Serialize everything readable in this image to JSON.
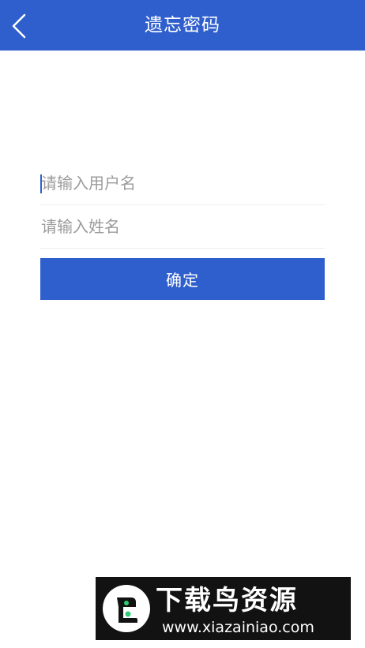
{
  "header": {
    "title": "遗忘密码",
    "back_icon": "chevron-left-icon"
  },
  "form": {
    "username_placeholder": "请输入用户名",
    "username_value": "",
    "name_placeholder": "请输入姓名",
    "name_value": "",
    "confirm_label": "确定"
  },
  "watermark": {
    "title": "下载鸟资源",
    "url": "www.xiazainiao.com",
    "logo_icon": "bird-logo-icon"
  },
  "colors": {
    "primary": "#2f5fcd",
    "background": "#ffffff",
    "placeholder": "#9b9b9b",
    "divider": "#eeeeee",
    "watermark_bg": "#121212",
    "watermark_accent": "#2ecc71"
  }
}
